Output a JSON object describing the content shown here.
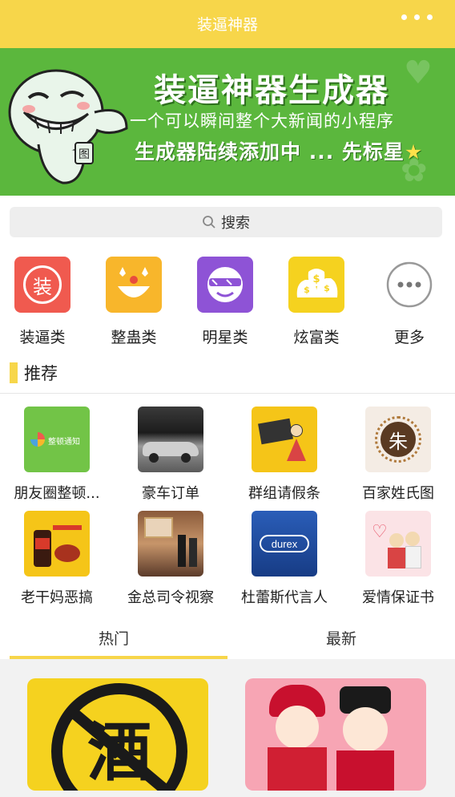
{
  "app": {
    "title": "装逼神器",
    "more_icon": "more-dots-icon"
  },
  "banner": {
    "title": "装逼神器生成器",
    "subtitle": "一个可以瞬间整个大新闻的小程序",
    "tagline": "生成器陆续添加中 ... 先标星",
    "mascot_icon": "grinning-mascot-icon",
    "badge_char": "图",
    "bg_color": "#5bb73d"
  },
  "search": {
    "label": "搜索",
    "icon": "search-icon"
  },
  "categories": [
    {
      "label": "装逼类",
      "icon": "zhuang-char-icon",
      "glyph": "装",
      "color": "#f05a4f"
    },
    {
      "label": "整蛊类",
      "icon": "clown-face-icon",
      "color": "#f8b62b"
    },
    {
      "label": "明星类",
      "icon": "sunglasses-face-icon",
      "color": "#8e53d6"
    },
    {
      "label": "炫富类",
      "icon": "money-bags-icon",
      "color": "#f5d21f"
    },
    {
      "label": "更多",
      "icon": "more-circle-icon",
      "color": "#ffffff"
    }
  ],
  "recommend": {
    "title": "推荐",
    "items": [
      {
        "label": "朋友圈整顿...",
        "icon": "wechat-moments-notice-thumb",
        "badge": "整顿通知"
      },
      {
        "label": "豪车订单",
        "icon": "luxury-car-thumb"
      },
      {
        "label": "群组请假条",
        "icon": "leave-note-thumb"
      },
      {
        "label": "百家姓氏图",
        "icon": "surname-seal-thumb",
        "glyph": "朱"
      },
      {
        "label": "老干妈恶搞",
        "icon": "laoganma-jar-thumb"
      },
      {
        "label": "金总司令视察",
        "icon": "inspection-photo-thumb"
      },
      {
        "label": "杜蕾斯代言人",
        "icon": "durex-logo-thumb",
        "brand": "durex"
      },
      {
        "label": "爱情保证书",
        "icon": "love-hearts-thumb"
      }
    ]
  },
  "tabs": [
    {
      "label": "热门",
      "active": true
    },
    {
      "label": "最新",
      "active": false
    }
  ],
  "cards": [
    {
      "icon": "no-alcohol-sign-thumb",
      "glyph": "酒"
    },
    {
      "icon": "wedding-couple-thumb"
    }
  ],
  "colors": {
    "accent": "#f7d64a",
    "banner": "#5bb73d"
  }
}
